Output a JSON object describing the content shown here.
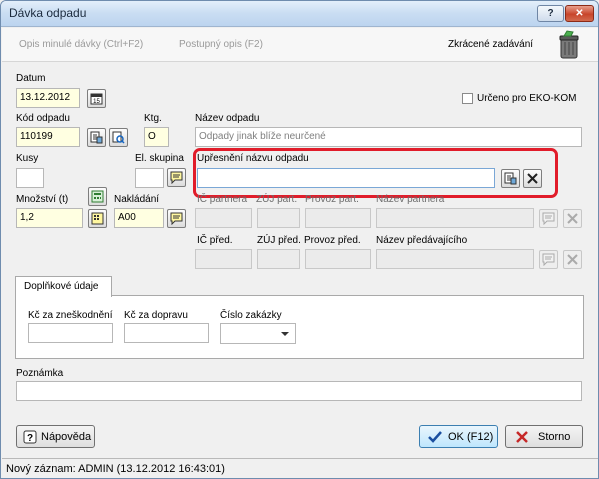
{
  "window": {
    "title": "Dávka odpadu",
    "help_label": "?",
    "close_label": "✕"
  },
  "toolbar": {
    "copy_last": "Opis minulé dávky (Ctrl+F2)",
    "gradual_copy": "Postupný opis (F2)",
    "short_entry": "Zkrácené zadávání"
  },
  "form": {
    "date_label": "Datum",
    "date_value": "13.12.2012",
    "eko_kom_label": "Určeno pro EKO-KOM",
    "waste_code_label": "Kód odpadu",
    "waste_code_value": "110199",
    "category_label": "Ktg.",
    "category_value": "O",
    "waste_name_label": "Název odpadu",
    "waste_name_value": "Odpady jinak blíže neurčené",
    "pieces_label": "Kusy",
    "pieces_value": "",
    "el_group_label": "El. skupina",
    "el_group_value": "",
    "name_detail_label": "Upřesnění názvu odpadu",
    "name_detail_value": "",
    "quantity_label": "Množství (t)",
    "quantity_value": "1,2",
    "handling_label": "Nakládání",
    "handling_value": "A00",
    "partner_ic_label": "IČ partnera",
    "partner_zuj_label": "ZÚJ part.",
    "partner_plant_label": "Provoz part.",
    "partner_name_label": "Název partnera",
    "prev_ic_label": "IČ před.",
    "prev_zuj_label": "ZÚJ před.",
    "prev_plant_label": "Provoz před.",
    "prev_name_label": "Název předávajícího"
  },
  "extra": {
    "tab_label": "Doplňkové údaje",
    "disposal_cost_label": "Kč za zneškodnění",
    "transport_cost_label": "Kč za dopravu",
    "order_number_label": "Číslo zakázky"
  },
  "note": {
    "label": "Poznámka",
    "value": ""
  },
  "buttons": {
    "help": "Nápověda",
    "ok": "OK (F12)",
    "cancel": "Storno"
  },
  "status": {
    "text": "Nový záznam: ADMIN (13.12.2012 16:43:01)"
  },
  "colors": {
    "highlight": "#e11c2a",
    "required_field": "#ffffe1"
  }
}
